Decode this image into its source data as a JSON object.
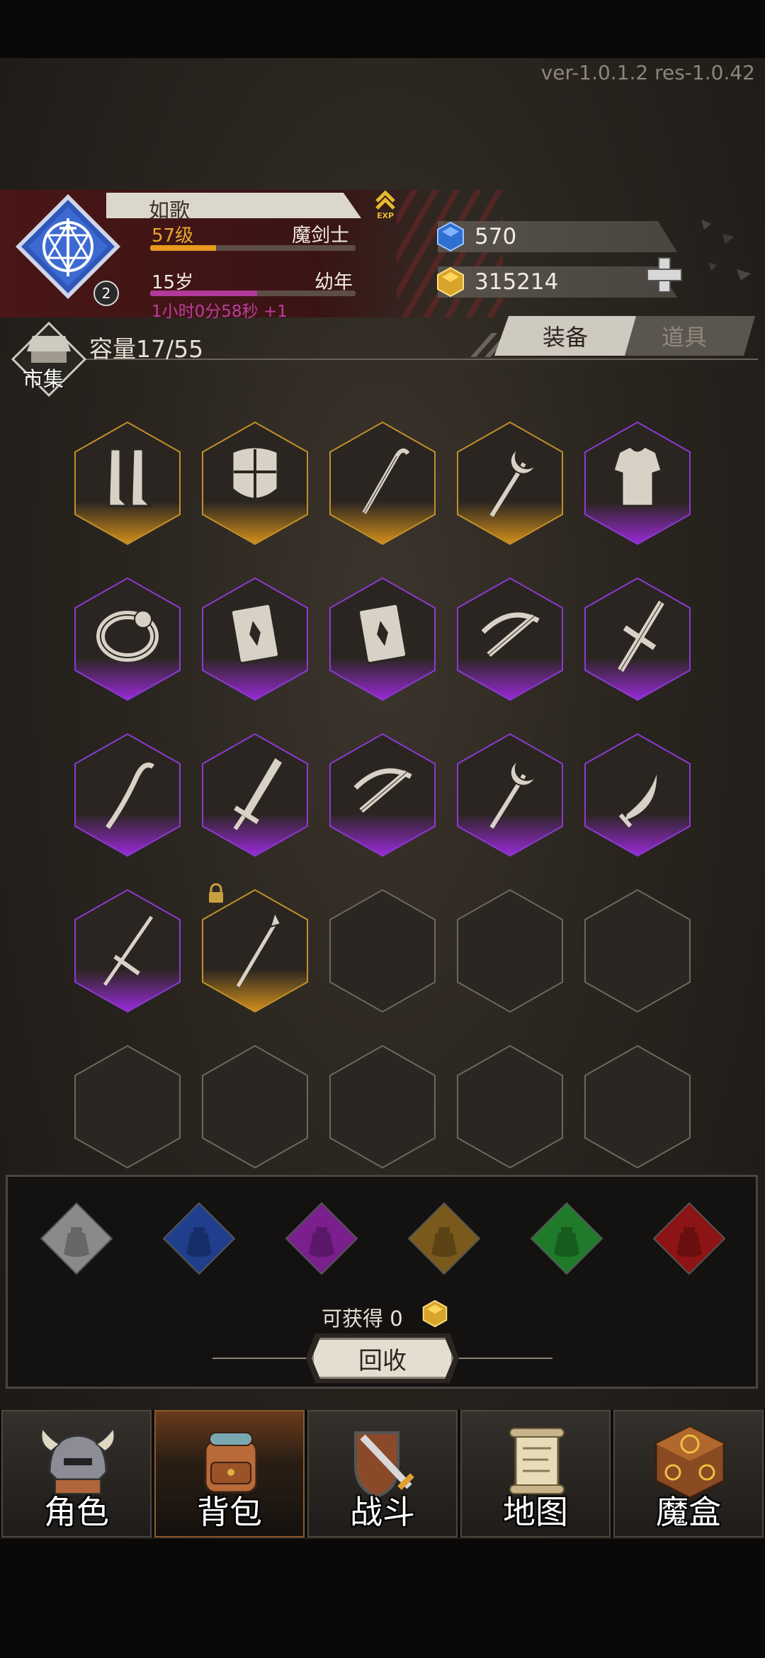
{
  "version": "ver-1.0.1.2  res-1.0.42",
  "player": {
    "name": "如歌",
    "level": "57级",
    "class": "魔剑士",
    "level_progress": 0.32,
    "age": "15岁",
    "stage": "幼年",
    "age_progress": 0.52,
    "timer": "1小时0分58秒 +1",
    "emblem_badge": "2",
    "exp_icon": "exp-up-arrow-icon"
  },
  "currency": {
    "diamonds": "570",
    "gold": "315214",
    "diamond_color": "#3a7bd5",
    "gold_color": "#e2b43a"
  },
  "inventory": {
    "market_label": "市集",
    "capacity": "容量17/55",
    "tabs": [
      {
        "label": "装备",
        "active": true
      },
      {
        "label": "道具",
        "active": false
      }
    ],
    "slots": [
      {
        "item": "boots",
        "rarity": "gold",
        "locked": false
      },
      {
        "item": "shield",
        "rarity": "gold",
        "locked": false
      },
      {
        "item": "cane",
        "rarity": "gold",
        "locked": false
      },
      {
        "item": "moon-staff",
        "rarity": "gold",
        "locked": false
      },
      {
        "item": "armor",
        "rarity": "purple",
        "locked": false
      },
      {
        "item": "ring",
        "rarity": "purple",
        "locked": false
      },
      {
        "item": "book",
        "rarity": "purple",
        "locked": false
      },
      {
        "item": "book",
        "rarity": "purple",
        "locked": false
      },
      {
        "item": "crossbow",
        "rarity": "purple",
        "locked": false
      },
      {
        "item": "cross-sword",
        "rarity": "purple",
        "locked": false
      },
      {
        "item": "staff",
        "rarity": "purple",
        "locked": false
      },
      {
        "item": "greatsword",
        "rarity": "purple",
        "locked": false
      },
      {
        "item": "crossbow",
        "rarity": "purple",
        "locked": false
      },
      {
        "item": "moon-staff",
        "rarity": "purple",
        "locked": false
      },
      {
        "item": "scimitar",
        "rarity": "purple",
        "locked": false
      },
      {
        "item": "rapier",
        "rarity": "purple",
        "locked": false
      },
      {
        "item": "spear",
        "rarity": "gold",
        "locked": true
      },
      {
        "item": "empty",
        "rarity": "none",
        "locked": false
      },
      {
        "item": "empty",
        "rarity": "none",
        "locked": false
      },
      {
        "item": "empty",
        "rarity": "none",
        "locked": false
      },
      {
        "item": "empty",
        "rarity": "none",
        "locked": false
      },
      {
        "item": "empty",
        "rarity": "none",
        "locked": false
      },
      {
        "item": "empty",
        "rarity": "none",
        "locked": false
      },
      {
        "item": "empty",
        "rarity": "none",
        "locked": false
      },
      {
        "item": "empty",
        "rarity": "none",
        "locked": false
      }
    ]
  },
  "recycle": {
    "bag_colors": [
      "#8a8a8a",
      "#1f3f8c",
      "#7a1f8c",
      "#7a5a1c",
      "#1f7a2a",
      "#8c1414"
    ],
    "obtain_label": "可获得 0",
    "button_label": "回收"
  },
  "nav": [
    {
      "label": "角色",
      "icon": "helmet-icon",
      "active": false
    },
    {
      "label": "背包",
      "icon": "backpack-icon",
      "active": true
    },
    {
      "label": "战斗",
      "icon": "sword-shield-icon",
      "active": false
    },
    {
      "label": "地图",
      "icon": "scroll-map-icon",
      "active": false
    },
    {
      "label": "魔盒",
      "icon": "magic-box-icon",
      "active": false
    }
  ]
}
